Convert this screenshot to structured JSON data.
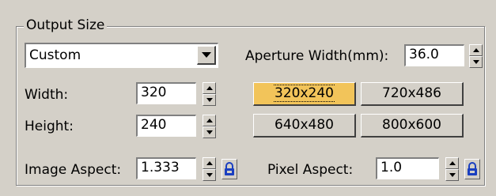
{
  "group": {
    "title": "Output Size"
  },
  "dropdown": {
    "value": "Custom"
  },
  "aperture": {
    "label": "Aperture Width(mm):",
    "value": "36.0"
  },
  "width": {
    "label": "Width:",
    "value": "320"
  },
  "height": {
    "label": "Height:",
    "value": "240"
  },
  "presets": [
    "320x240",
    "720x486",
    "640x480",
    "800x600"
  ],
  "active_preset": "320x240",
  "image_aspect": {
    "label": "Image Aspect:",
    "value": "1.333"
  },
  "pixel_aspect": {
    "label": "Pixel Aspect:",
    "value": "1.0"
  },
  "icons": {
    "lock": "lock-icon",
    "spinner": "spinner-arrows",
    "dropdown": "chevron-down-icon"
  },
  "colors": {
    "active_button": "#f2c45a",
    "panel": "#d4d0c8",
    "lock": "#1a3fc0"
  }
}
